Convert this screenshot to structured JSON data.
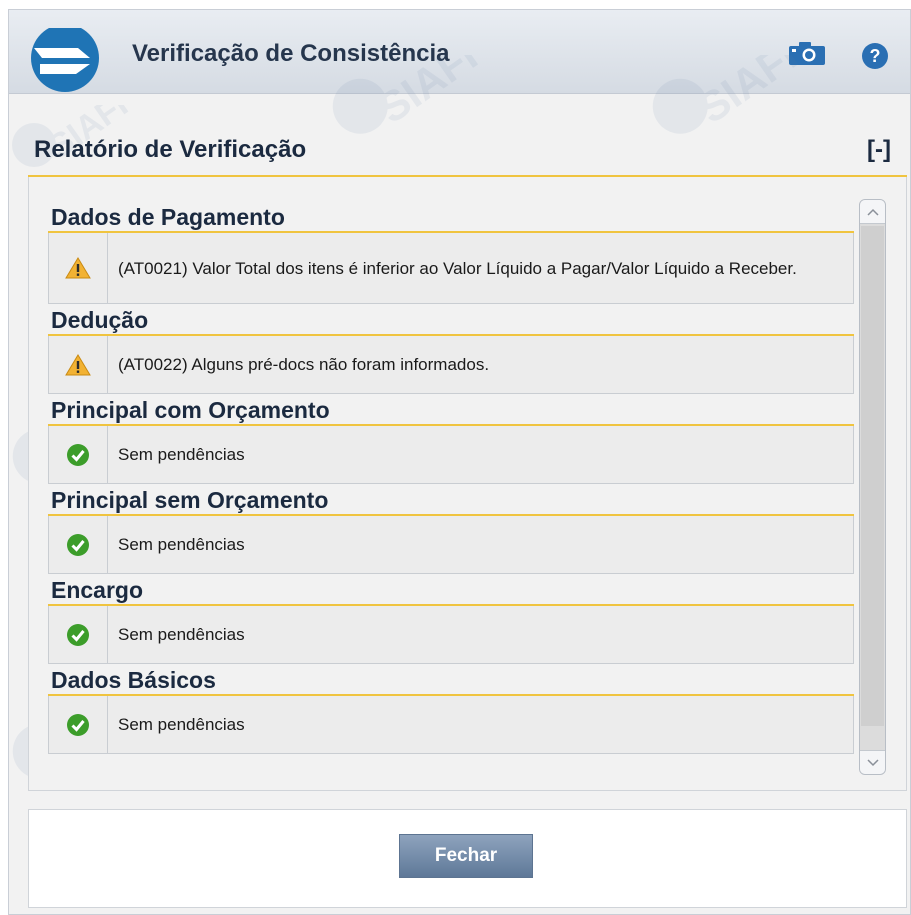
{
  "window": {
    "title": "Verificação de Consistência"
  },
  "report": {
    "title": "Relatório de Verificação",
    "toggle_label": "[-]"
  },
  "groups": [
    {
      "title": "Dados de Pagamento",
      "status": "warning",
      "message": "(AT0021) Valor Total dos itens é inferior ao Valor Líquido a Pagar/Valor Líquido a Receber."
    },
    {
      "title": "Dedução",
      "status": "warning",
      "message": "(AT0022) Alguns pré-docs não foram informados."
    },
    {
      "title": "Principal com Orçamento",
      "status": "ok",
      "message": "Sem pendências"
    },
    {
      "title": "Principal sem Orçamento",
      "status": "ok",
      "message": "Sem pendências"
    },
    {
      "title": "Encargo",
      "status": "ok",
      "message": "Sem pendências"
    },
    {
      "title": "Dados Básicos",
      "status": "ok",
      "message": "Sem pendências"
    }
  ],
  "footer": {
    "close_label": "Fechar"
  },
  "icons": {
    "logo": "siafi-logo-icon",
    "screenshot": "camera-icon",
    "help": "help-icon",
    "warning": "warning-icon",
    "ok": "check-circle-icon"
  },
  "colors": {
    "accent_line": "#f0c43f",
    "button": "#6d85a4",
    "warning": "#f2b233",
    "ok": "#3c9d2a"
  }
}
